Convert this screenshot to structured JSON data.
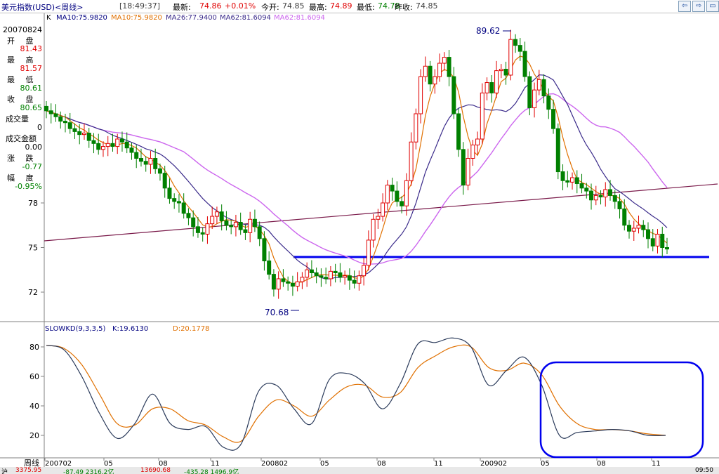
{
  "header": {
    "title": "美元指数(USD)<周线>",
    "time": "[18:49:37]",
    "latest_label": "最新:",
    "latest_value": "74.86",
    "change": "+0.01%",
    "open_label": "今开:",
    "open_value": "74.85",
    "high_label": "最高:",
    "high_value": "74.89",
    "low_label": "最低:",
    "low_value": "74.78",
    "prev_label": "昨收:",
    "prev_value": "74.85"
  },
  "ma_bar": {
    "k": "K",
    "ma10a": "MA10:75.9820",
    "ma10b": "MA10:75.9820",
    "ma26": "MA26:77.9400",
    "ma62a": "MA62:81.6094",
    "ma62b": "MA62:81.6094"
  },
  "sidebar": {
    "date": "20070824",
    "open_label": "开 盘",
    "open_value": "81.43",
    "high_label": "最 高",
    "high_value": "81.57",
    "low_label": "最 低",
    "low_value": "80.61",
    "close_label": "收 盘",
    "close_value": "80.65",
    "volume_label": "成交量",
    "volume_value": "0",
    "amount_label": "成交金额",
    "amount_value": "0.00",
    "change_label": "涨 跌",
    "change_value": "-0.77",
    "range_label": "幅 度",
    "range_value": "-0.95%"
  },
  "indicator_header": {
    "name": "SLOWKD(9,3,3,5)",
    "k": "K:19.6130",
    "d": "D:20.1778"
  },
  "bottom_bar": {
    "a": "沪",
    "b": "3375.95",
    "c": "-87.49 2316.2亿",
    "d": "13690.68",
    "e": "-435.28 1496.9亿",
    "f": "09:50"
  },
  "colors": {
    "up": "#e00000",
    "down": "#008000",
    "ma10": "#e07000",
    "ma26": "#3a2a8a",
    "ma62": "#cc66ee",
    "trend": "#7a1a4a",
    "support": "#0000ee",
    "k_line": "#2a3a5a",
    "d_line": "#e07000"
  },
  "chart_data": [
    {
      "type": "candlestick",
      "title": "美元指数(USD)<周线>",
      "y_ticks": [
        72,
        75,
        78
      ],
      "ylim": [
        70.0,
        90.5
      ],
      "x_ticks": [
        "200702",
        "05",
        "08",
        "11",
        "200802",
        "05",
        "08",
        "11",
        "200902",
        "05",
        "08",
        "11"
      ],
      "annotations": [
        {
          "label": "89.62",
          "type": "high"
        },
        {
          "label": "70.68",
          "type": "low"
        }
      ],
      "close": [
        84.2,
        84.0,
        83.8,
        83.5,
        83.4,
        83.0,
        82.8,
        82.6,
        82.7,
        82.2,
        82.0,
        81.6,
        81.8,
        82.0,
        81.8,
        82.3,
        82.1,
        81.7,
        81.4,
        81.0,
        80.8,
        80.6,
        81.0,
        80.3,
        80.0,
        79.0,
        78.3,
        78.1,
        78.0,
        77.3,
        77.0,
        76.4,
        76.0,
        75.9,
        76.6,
        77.1,
        77.4,
        76.8,
        76.5,
        76.4,
        76.7,
        76.2,
        76.0,
        76.9,
        76.4,
        75.6,
        74.1,
        73.2,
        72.2,
        72.9,
        72.7,
        72.6,
        72.4,
        72.7,
        73.0,
        73.5,
        73.3,
        73.1,
        73.0,
        72.9,
        73.4,
        73.3,
        73.0,
        73.1,
        72.8,
        72.6,
        73.1,
        73.8,
        75.5,
        76.9,
        77.1,
        78.0,
        79.2,
        78.8,
        78.1,
        77.8,
        79.5,
        82.1,
        84.0,
        86.5,
        87.2,
        86.0,
        86.5,
        87.4,
        87.8,
        86.5,
        84.0,
        81.6,
        79.2,
        81.0,
        81.9,
        82.3,
        85.4,
        86.1,
        85.4,
        86.9,
        87.0,
        86.6,
        89.0,
        88.6,
        88.2,
        86.5,
        84.4,
        85.6,
        86.3,
        85.2,
        84.3,
        83.0,
        80.1,
        79.5,
        79.4,
        79.7,
        79.3,
        79.0,
        78.8,
        78.2,
        78.5,
        78.4,
        78.9,
        78.5,
        78.1,
        77.6,
        76.5,
        76.1,
        76.3,
        76.5,
        76.2,
        75.6,
        75.1,
        75.9,
        75.0,
        74.9
      ]
    },
    {
      "type": "line",
      "title": "SLOWKD(9,3,3,5)",
      "y_ticks": [
        20,
        40,
        60,
        80
      ],
      "ylim": [
        7,
        88
      ],
      "series": [
        {
          "name": "K",
          "values": [
            81,
            78,
            60,
            35,
            18,
            28,
            48,
            28,
            24,
            26,
            12,
            14,
            50,
            54,
            38,
            28,
            58,
            62,
            55,
            38,
            55,
            82,
            83,
            86,
            80,
            54,
            64,
            73,
            54,
            20,
            22,
            23,
            24,
            23,
            20,
            20
          ]
        },
        {
          "name": "D",
          "values": [
            81,
            79,
            68,
            48,
            28,
            27,
            38,
            38,
            30,
            27,
            19,
            16,
            33,
            44,
            40,
            33,
            44,
            53,
            54,
            46,
            49,
            66,
            74,
            80,
            80,
            66,
            64,
            69,
            61,
            40,
            28,
            24,
            24,
            23,
            21,
            20
          ]
        }
      ]
    }
  ]
}
